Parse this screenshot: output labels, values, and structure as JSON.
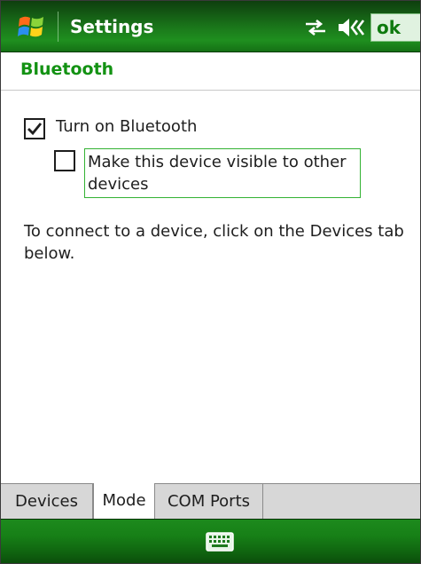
{
  "titlebar": {
    "title": "Settings",
    "ok_label": "ok",
    "icons": [
      "windows-start-icon",
      "connectivity-icon",
      "volume-icon"
    ]
  },
  "header": {
    "title": "Bluetooth"
  },
  "options": {
    "bluetooth_label": "Turn on Bluetooth",
    "bluetooth_checked": true,
    "visible_label": "Make this device visible to other devices",
    "visible_checked": false
  },
  "info": {
    "text": "To connect to a device, click on the Devices tab below."
  },
  "tabs": [
    {
      "label": "Devices",
      "selected": false
    },
    {
      "label": "Mode",
      "selected": true
    },
    {
      "label": "COM Ports",
      "selected": false
    }
  ],
  "softbar": {
    "icon": "keyboard-icon"
  },
  "colors": {
    "accent_green": "#139213",
    "titlebar_green": "#1b7a1b",
    "ok_text": "#0f7a0f"
  }
}
